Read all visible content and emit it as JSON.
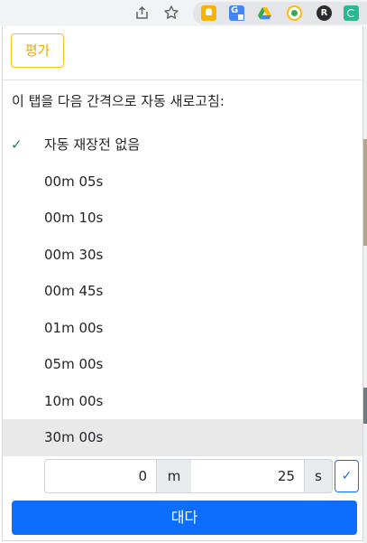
{
  "browser": {
    "extensions": [
      "keep-icon",
      "translate-icon",
      "drive-icon",
      "rocket-icon",
      "r-icon",
      "auto-refresh-icon"
    ],
    "r_letter": "R"
  },
  "popup": {
    "rate_label": "평가",
    "description": "이 탭을 다음 간격으로 자동 새로고침:",
    "check_mark": "✓",
    "options": [
      {
        "label": "자동 재장전 없음",
        "checked": true
      },
      {
        "label": "00m 05s"
      },
      {
        "label": "00m 10s"
      },
      {
        "label": "00m 30s"
      },
      {
        "label": "00m 45s"
      },
      {
        "label": "01m 00s"
      },
      {
        "label": "05m 00s"
      },
      {
        "label": "10m 00s"
      },
      {
        "label": "30m 00s",
        "hovered": true
      }
    ],
    "custom": {
      "minutes_value": "0",
      "minutes_unit": "m",
      "seconds_value": "25",
      "seconds_unit": "s",
      "confirm_label": "✓"
    },
    "close_label": "대다"
  },
  "colors": {
    "primary": "#0d6efd",
    "warning": "#ffc107",
    "success": "#198754"
  }
}
